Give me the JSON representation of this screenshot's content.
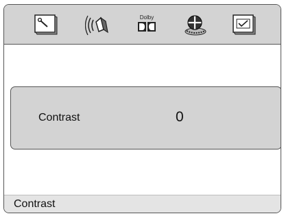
{
  "toolbar": {
    "icons": [
      {
        "name": "general-setup-icon"
      },
      {
        "name": "audio-speaker-icon"
      },
      {
        "name": "dolby-icon",
        "text": "Dolby"
      },
      {
        "name": "video-film-icon"
      },
      {
        "name": "preference-check-icon"
      }
    ]
  },
  "setting": {
    "label": "Contrast",
    "value": "0"
  },
  "status": {
    "text": "Contrast"
  },
  "colors": {
    "bar_bg": "#d3d3d3",
    "panel_bg": "#d3d3d3",
    "status_bg": "#e4e4e4",
    "border": "#555555"
  }
}
